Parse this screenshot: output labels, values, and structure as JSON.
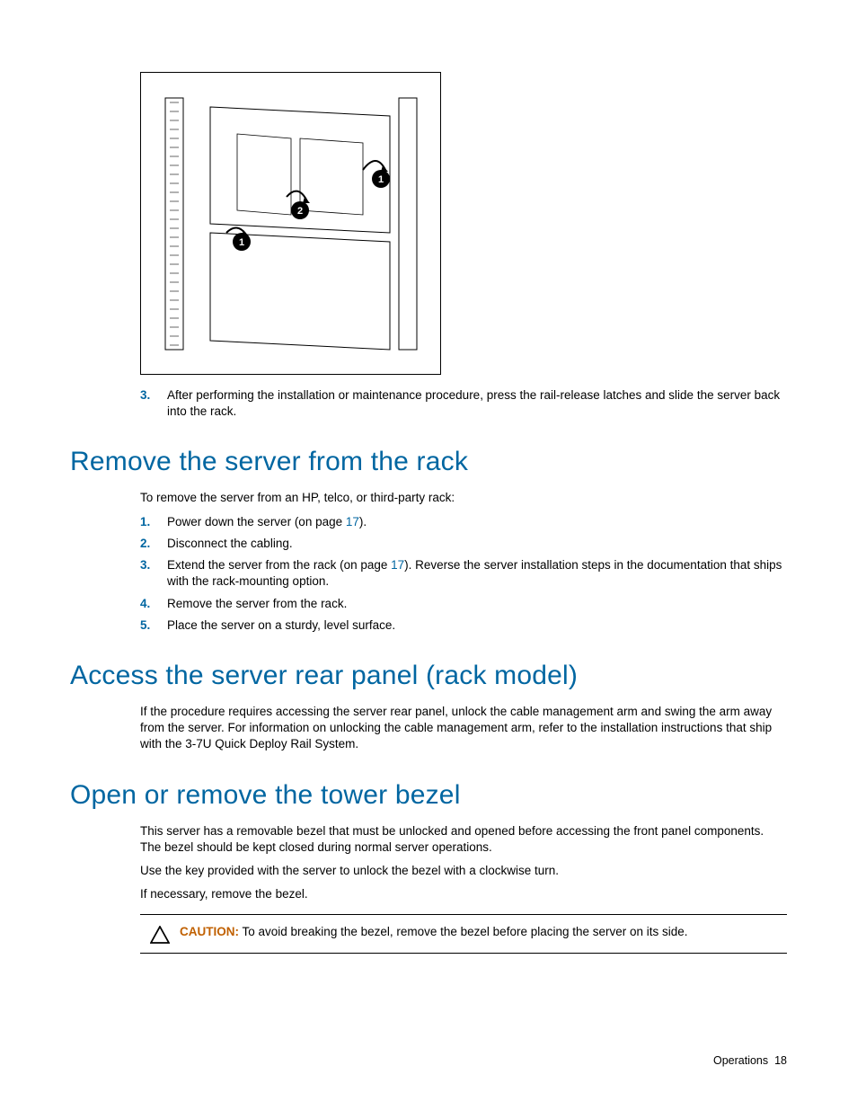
{
  "top_step": {
    "num": "3.",
    "text": "After performing the installation or maintenance procedure, press the rail-release latches and slide the server back into the rack."
  },
  "section1": {
    "heading": "Remove the server from the rack",
    "intro": "To remove the server from an HP, telco, or third-party rack:",
    "steps": [
      {
        "num": "1.",
        "pre": "Power down the server (on page ",
        "link": "17",
        "post": ")."
      },
      {
        "num": "2.",
        "pre": "Disconnect the cabling."
      },
      {
        "num": "3.",
        "pre": "Extend the server from the rack (on page ",
        "link": "17",
        "post": "). Reverse the server installation steps in the documentation that ships with the rack-mounting option."
      },
      {
        "num": "4.",
        "pre": "Remove the server from the rack."
      },
      {
        "num": "5.",
        "pre": "Place the server on a sturdy, level surface."
      }
    ]
  },
  "section2": {
    "heading": "Access the server rear panel (rack model)",
    "para": "If the procedure requires accessing the server rear panel, unlock the cable management arm and swing the arm away from the server. For information on unlocking the cable management arm, refer to the installation instructions that ship with the 3-7U Quick Deploy Rail System."
  },
  "section3": {
    "heading": "Open or remove the tower bezel",
    "p1": "This server has a removable bezel that must be unlocked and opened before accessing the front panel components. The bezel should be kept closed during normal server operations.",
    "p2": "Use the key provided with the server to unlock the bezel with a clockwise turn.",
    "p3": "If necessary, remove the bezel.",
    "caution_label": "CAUTION:",
    "caution_text": " To avoid breaking the bezel, remove the bezel before placing the server on its side."
  },
  "footer": {
    "section": "Operations",
    "page": "18"
  }
}
